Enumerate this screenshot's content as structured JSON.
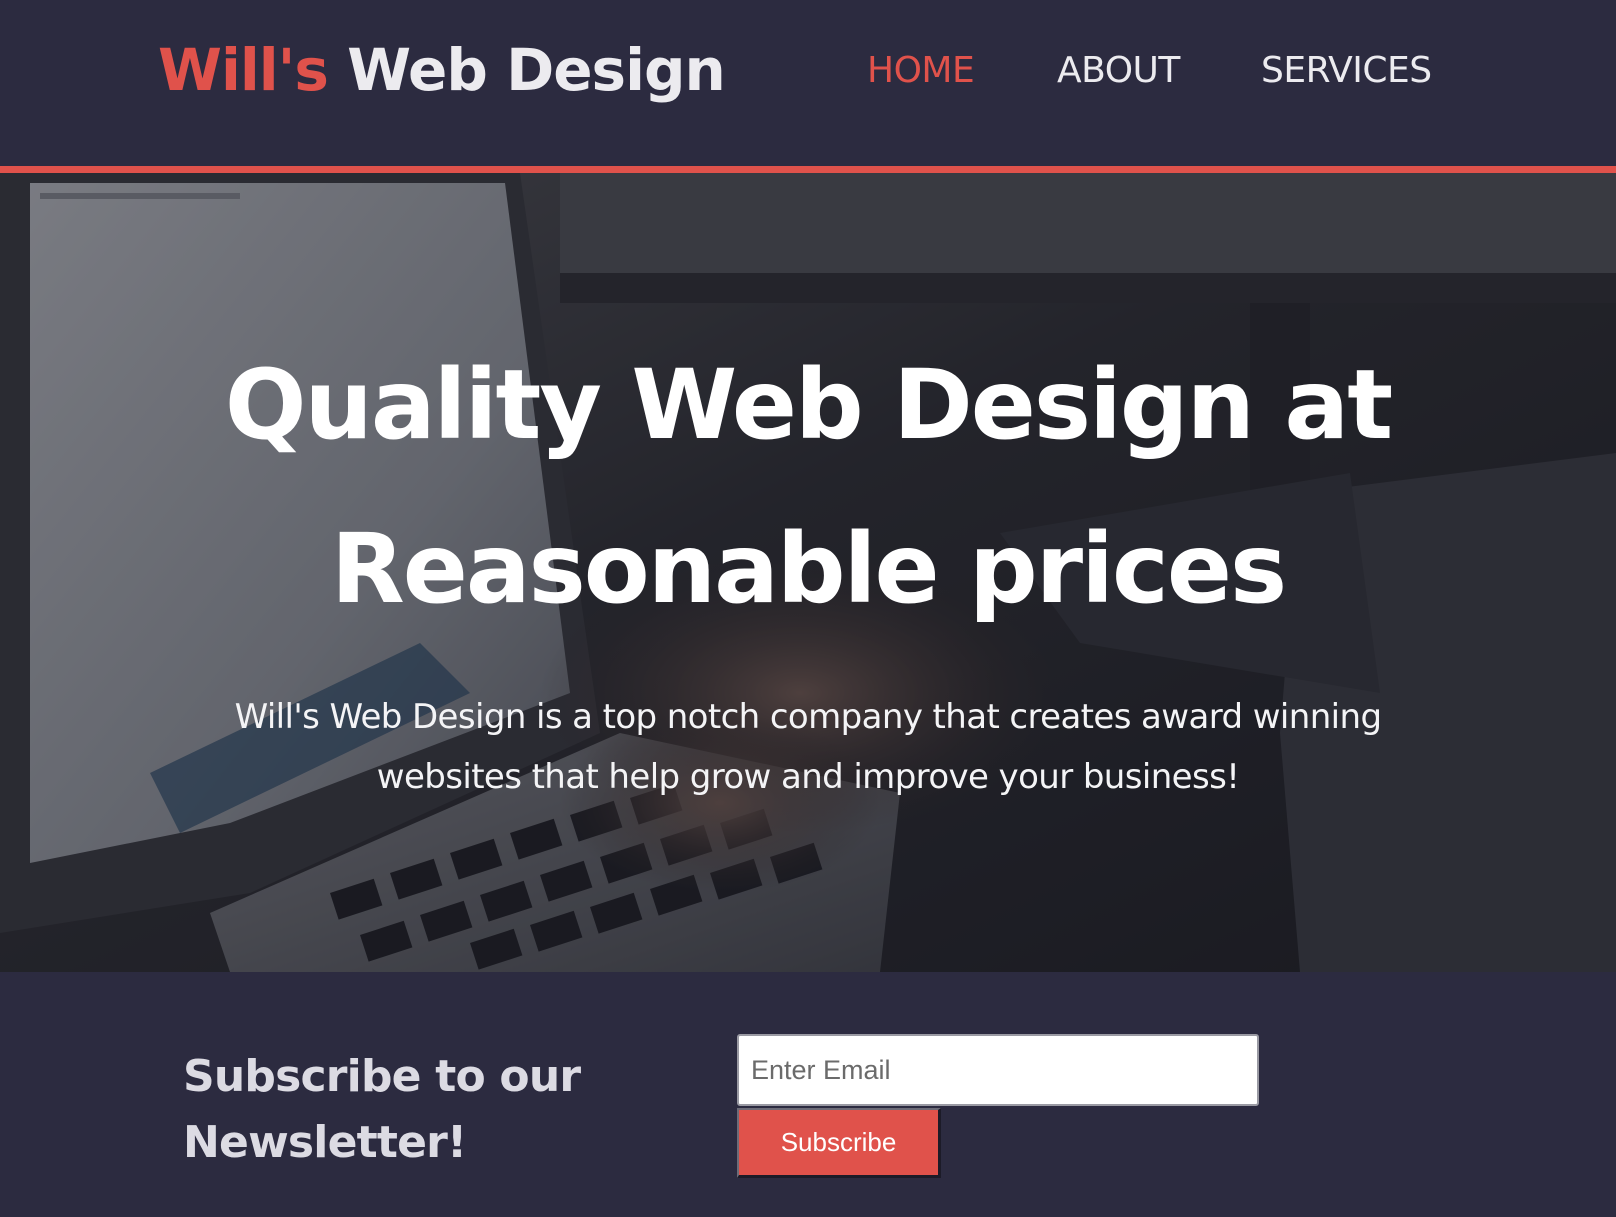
{
  "header": {
    "logo_accent": "Will's",
    "logo_main": "Web Design",
    "nav": [
      {
        "label": "HOME",
        "active": true
      },
      {
        "label": "ABOUT",
        "active": false
      },
      {
        "label": "SERVICES",
        "active": false
      }
    ]
  },
  "hero": {
    "title": "Quality Web Design at Reasonable prices",
    "text": "Will's Web Design is a top notch company that creates award winning websites that help grow and improve your business!"
  },
  "newsletter": {
    "title": "Subscribe to our Newsletter!",
    "email_placeholder": "Enter Email",
    "button_label": "Subscribe"
  },
  "colors": {
    "background": "#2c2b40",
    "accent": "#e0524b",
    "text_light": "#ecebef"
  }
}
